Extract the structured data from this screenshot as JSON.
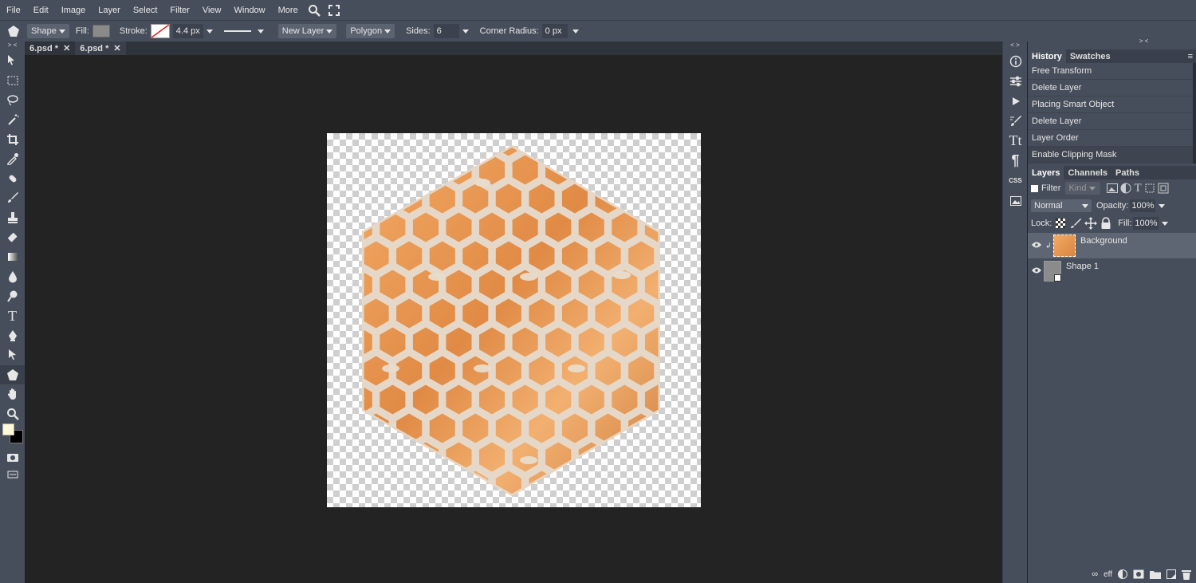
{
  "menu": [
    "File",
    "Edit",
    "Image",
    "Layer",
    "Select",
    "Filter",
    "View",
    "Window",
    "More"
  ],
  "options": {
    "tool_mode": "Shape",
    "fill_label": "Fill:",
    "stroke_label": "Stroke:",
    "stroke_width": "4.4 px",
    "layer_mode": "New Layer",
    "shape_type": "Polygon",
    "sides_label": "Sides:",
    "sides_value": "6",
    "corner_radius_label": "Corner Radius:",
    "corner_radius_value": "0 px"
  },
  "tabs": [
    {
      "label": "6.psd *"
    },
    {
      "label": "6.psd *"
    }
  ],
  "panel_toggle_left": "> <",
  "panel_toggle_mid": "< >",
  "panel_toggle_right": "> <",
  "history": {
    "tabs": [
      "History",
      "Swatches"
    ],
    "items": [
      "Free Transform",
      "Delete Layer",
      "Placing Smart Object",
      "Delete Layer",
      "Layer Order",
      "Enable Clipping Mask"
    ]
  },
  "layers": {
    "tabs": [
      "Layers",
      "Channels",
      "Paths"
    ],
    "filter_label": "Filter",
    "kind_label": "Kind",
    "blend_mode": "Normal",
    "opacity_label": "Opacity:",
    "opacity_value": "100%",
    "lock_label": "Lock:",
    "fill_label": "Fill:",
    "fill_value": "100%",
    "items": [
      {
        "name": "Background",
        "selected": true
      },
      {
        "name": "Shape 1",
        "selected": false
      }
    ]
  },
  "rightstrip": {
    "css_label": "CSS"
  },
  "bottom": {
    "eff_label": "eff"
  },
  "colors": {
    "ui_bg": "#474e5b",
    "doc_bg": "#232323",
    "honey_light": "#f0a45a",
    "honey_dark": "#c9773a",
    "comb_line": "#e6d8c8",
    "foreground": "#fffbd6",
    "background": "#000000"
  }
}
